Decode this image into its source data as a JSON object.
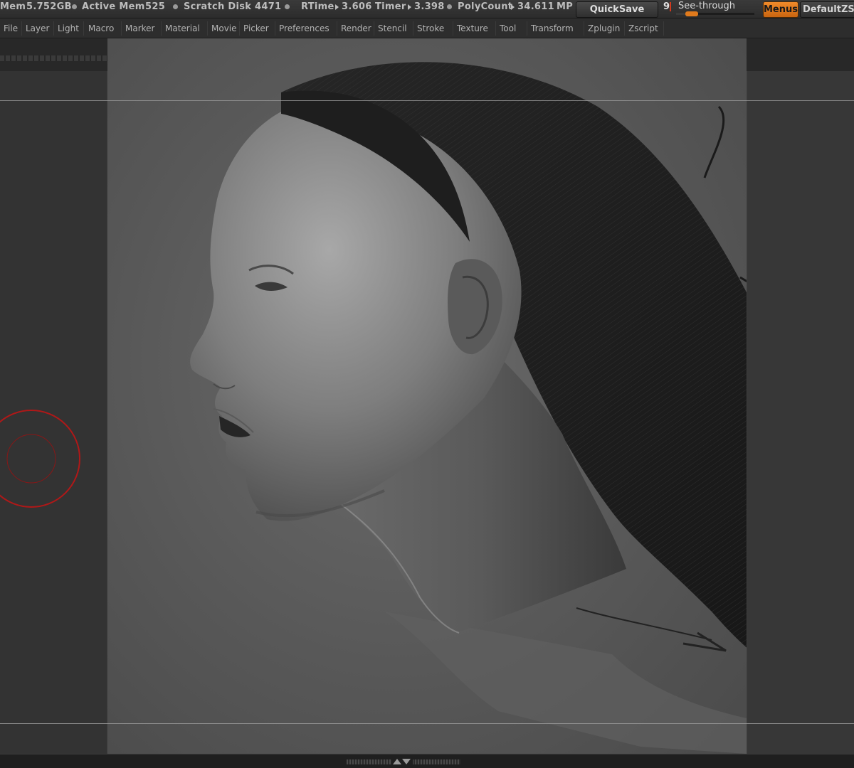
{
  "status": {
    "mem_label": "Mem",
    "mem_value": "5.752GB",
    "active_mem_label": "Active Mem",
    "active_mem_value": "525",
    "scratch_label": "Scratch Disk",
    "scratch_value": "4471",
    "rtime_label": "RTime",
    "rtime_value": "3.606",
    "timer_label": "Timer",
    "timer_value": "3.398",
    "polycount_label": "PolyCount",
    "polycount_value": "34.611",
    "polycount_unit": "MP"
  },
  "toolbar": {
    "quicksave_label": "QuickSave",
    "seethrough_value": "9",
    "seethrough_label": "See-through",
    "seethrough_level_fraction": 0.14,
    "menus_label": "Menus",
    "ui_preset_label": "DefaultZScript"
  },
  "menubar": {
    "items": [
      "File",
      "Layer",
      "Light",
      "Macro",
      "Marker",
      "Material",
      "Movie",
      "Picker",
      "Preferences",
      "Render",
      "Stencil",
      "Stroke",
      "Texture",
      "Tool",
      "Transform",
      "Zplugin",
      "Zscript"
    ]
  },
  "colors": {
    "accent": "#e07a1c",
    "brush_cursor": "#b01818",
    "canvas_bg": "#5c5c5c",
    "tray_bg": "#333333"
  },
  "icons": {
    "brush_cursor": "brush-circle-icon",
    "bottom_toggle": "expand-collapse-icon"
  }
}
